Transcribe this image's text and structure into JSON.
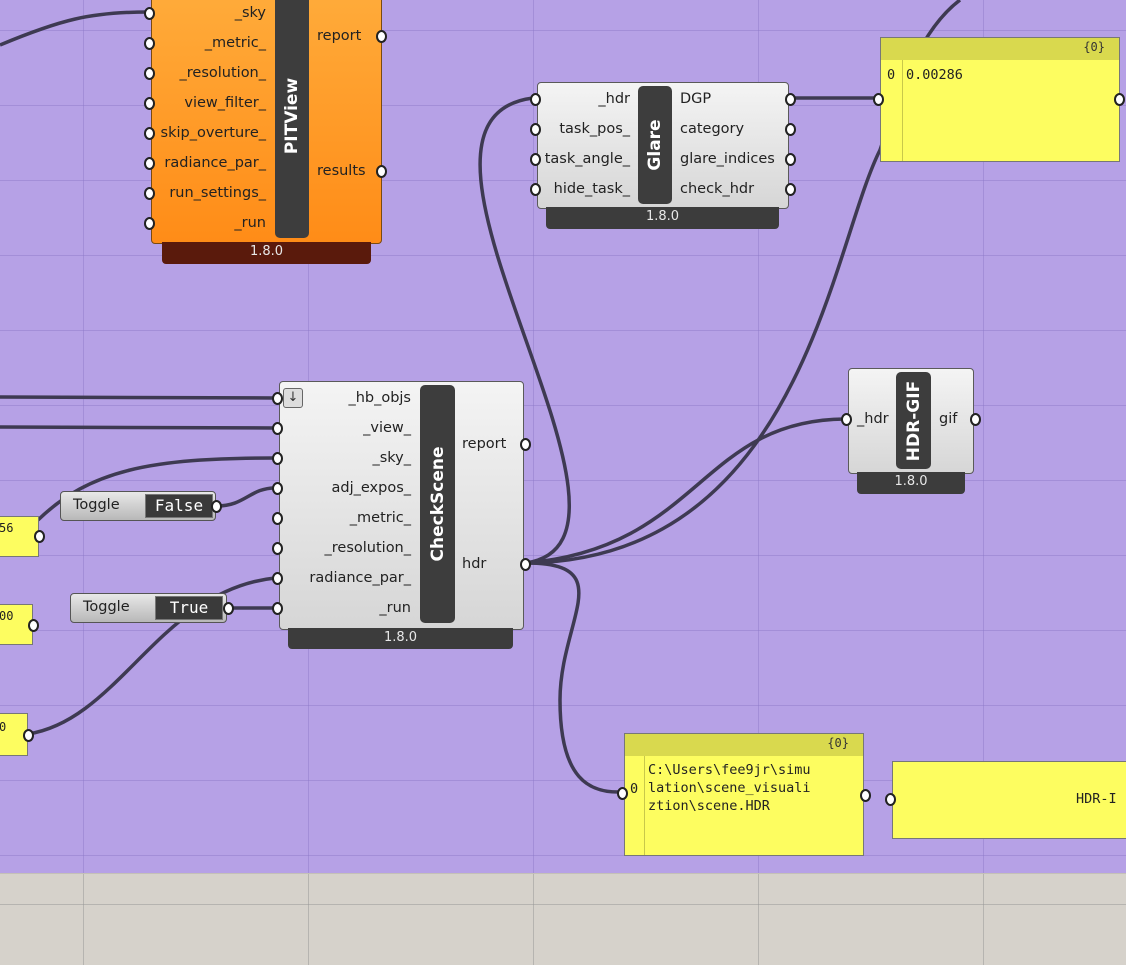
{
  "pitview": {
    "title": "PITView",
    "inputs": [
      "_sky",
      "_metric_",
      "_resolution_",
      "view_filter_",
      "skip_overture_",
      "radiance_par_",
      "run_settings_",
      "_run"
    ],
    "outputs": [
      "report",
      "results"
    ],
    "version": "1.8.0"
  },
  "glare": {
    "title": "Glare",
    "inputs": [
      "_hdr",
      "task_pos_",
      "task_angle_",
      "hide_task_"
    ],
    "outputs": [
      "DGP",
      "category",
      "glare_indices",
      "check_hdr"
    ],
    "version": "1.8.0"
  },
  "checkscene": {
    "title": "CheckScene",
    "inputs": [
      "_hb_objs",
      "_view_",
      "_sky_",
      "adj_expos_",
      "_metric_",
      "_resolution_",
      "radiance_par_",
      "_run"
    ],
    "outputs": [
      "report",
      "hdr"
    ],
    "version": "1.8.0",
    "arrow_icon": "↓"
  },
  "hdrgif": {
    "title": "HDR-GIF",
    "inputs": [
      "_hdr"
    ],
    "outputs": [
      "gif"
    ],
    "version": "1.8.0"
  },
  "toggle_false": {
    "label": "Toggle",
    "value": "False"
  },
  "toggle_true": {
    "label": "Toggle",
    "value": "True"
  },
  "panel_dgp": {
    "header": "{0}",
    "index": "0",
    "value": "0.00286"
  },
  "panel_path": {
    "header": "{0}",
    "index": "0",
    "lines": [
      "C:\\Users\\fee9jr\\simu",
      "lation\\scene_visuali",
      "ztion\\scene.HDR"
    ]
  },
  "panel_hdr_right": {
    "value": "HDR-I"
  },
  "left_panels": [
    "56",
    "00",
    "0"
  ],
  "colors": {
    "canvas": "#b6a1e6",
    "wire": "#3e3a52",
    "panel": "#fdfd60",
    "orange": "#ff9620"
  }
}
